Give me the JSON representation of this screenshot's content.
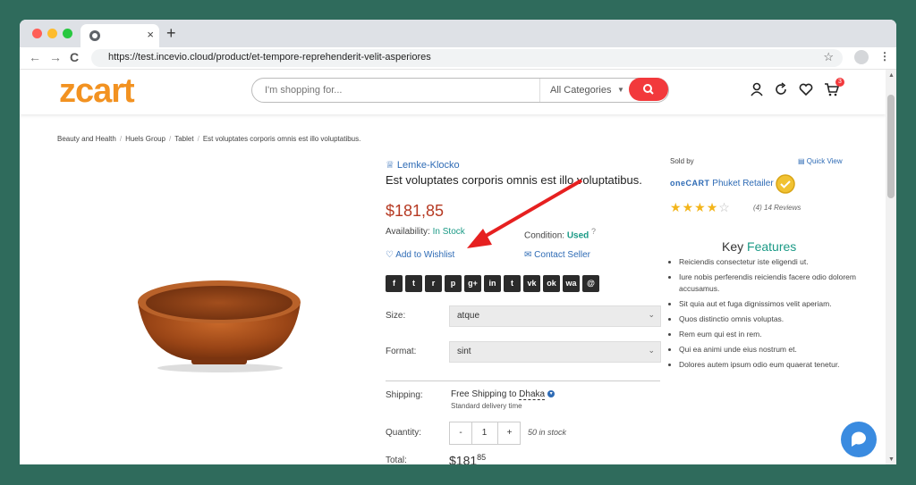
{
  "browser": {
    "url": "https://test.incevio.cloud/product/et-tempore-reprehenderit-velit-asperiores",
    "tab_close": "×",
    "new_tab": "+",
    "nav_back": "←",
    "nav_forward": "→",
    "nav_reload": "C",
    "bookmark_star": "☆",
    "menu": "⋮",
    "lights": {
      "red": "#ff5f57",
      "yellow": "#febc2e",
      "green": "#28c840"
    }
  },
  "header": {
    "logo": "zcart",
    "search_placeholder": "I'm shopping for...",
    "category": "All Categories",
    "cart_count": "3",
    "accent": "#f2393c",
    "logo_color": "#f29221"
  },
  "breadcrumb": [
    "Beauty and Health",
    "Huels Group",
    "Tablet",
    "Est voluptates corporis omnis est illo voluptatibus."
  ],
  "product": {
    "brand": "Lemke-Klocko",
    "title": "Est voluptates corporis omnis est illo voluptatibus.",
    "price": "$181,85",
    "availability_label": "Availability:",
    "availability_value": "In Stock",
    "condition_label": "Condition:",
    "condition_value": "Used",
    "condition_help": "?",
    "wishlist": "Add to Wishlist",
    "contact": "Contact Seller",
    "share": [
      "f",
      "t",
      "r",
      "p",
      "g+",
      "in",
      "t",
      "vk",
      "ok",
      "wa",
      "@"
    ],
    "size_label": "Size:",
    "size_value": "atque",
    "format_label": "Format:",
    "format_value": "sint",
    "shipping_label": "Shipping:",
    "shipping_value": "Free Shipping to",
    "shipping_dest": "Dhaka",
    "shipping_sub": "Standard delivery time",
    "quantity_label": "Quantity:",
    "qty_minus": "-",
    "qty_value": "1",
    "qty_plus": "+",
    "stock_note": "50 in stock",
    "total_label": "Total:",
    "total_main": "$181",
    "total_cents": "85"
  },
  "seller": {
    "sold_by": "Sold by",
    "quick_view": "Quick View",
    "logo_text": "oneCART",
    "name": "Phuket Retailer",
    "rating": 4,
    "rating_max": 5,
    "rating_text": "(4)",
    "reviews": "14 Reviews"
  },
  "features": {
    "heading_a": "Key",
    "heading_b": "Features",
    "items": [
      "Reiciendis consectetur iste eligendi ut.",
      "Iure nobis perferendis reiciendis facere odio dolorem accusamus.",
      "Sit quia aut et fuga dignissimos velit aperiam.",
      "Quos distinctio omnis voluptas.",
      "Rem eum qui est in rem.",
      "Qui ea animi unde eius nostrum et.",
      "Dolores autem ipsum odio eum quaerat tenetur."
    ]
  },
  "colors": {
    "link": "#2e6bb5",
    "price": "#b63a23",
    "green": "#1b9a86",
    "star": "#f3b51b",
    "background": "#2f6b5c"
  }
}
